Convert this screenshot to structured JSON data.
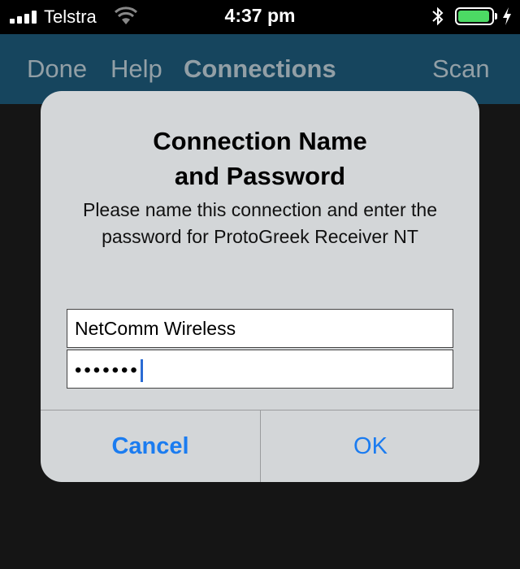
{
  "status_bar": {
    "carrier": "Telstra",
    "time": "4:37 pm",
    "battery_color": "#4cd964"
  },
  "nav_bar": {
    "done_label": "Done",
    "help_label": "Help",
    "title": "Connections",
    "scan_label": "Scan",
    "color": "#1a4f6b"
  },
  "dialog": {
    "title_line1": "Connection Name",
    "title_line2": "and Password",
    "message": "Please name this connection and enter the password for ProtoGreek Receiver NT",
    "name_field_value": "NetComm Wireless",
    "password_field_value": "•••••••",
    "cancel_label": "Cancel",
    "ok_label": "OK",
    "button_color": "#1b7cf0"
  }
}
